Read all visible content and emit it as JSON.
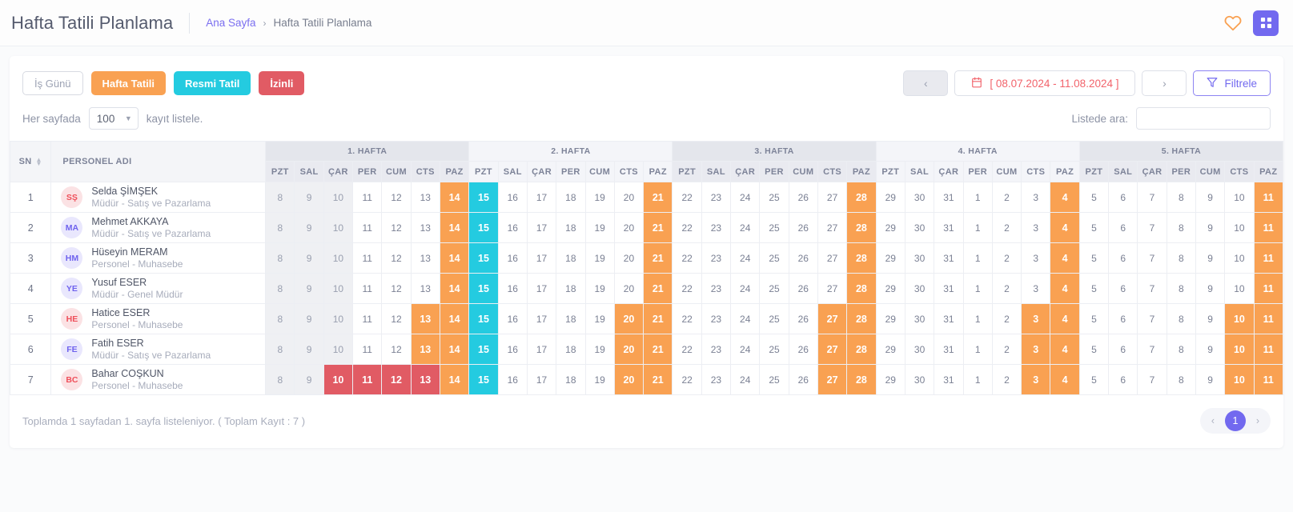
{
  "header": {
    "title": "Hafta Tatili Planlama",
    "breadcrumb_home": "Ana Sayfa",
    "breadcrumb_sep": "›",
    "breadcrumb_current": "Hafta Tatili Planlama",
    "heart_icon": "heart-icon",
    "grid_icon": "grid-apps-icon",
    "accent": "#7269ef"
  },
  "legend": [
    {
      "label": "İş Günü",
      "key": "work",
      "color": "#ffffff"
    },
    {
      "label": "Hafta Tatili",
      "key": "weekend",
      "color": "#f9a152"
    },
    {
      "label": "Resmi Tatil",
      "key": "official",
      "color": "#24cbe0"
    },
    {
      "label": "İzinli",
      "key": "leave",
      "color": "#e15b64"
    }
  ],
  "toolbar": {
    "prev_label": "‹",
    "next_label": "›",
    "date_range": "[ 08.07.2024 - 11.08.2024 ]",
    "calendar_icon": "calendar-icon",
    "filter_label": "Filtrele",
    "filter_icon": "funnel-icon"
  },
  "controls": {
    "per_page_prefix": "Her sayfada",
    "per_page_value": "100",
    "per_page_suffix": "kayıt listele.",
    "search_label": "Listede ara:",
    "search_value": "",
    "search_placeholder": ""
  },
  "table": {
    "col_sn": "SN",
    "col_name": "PERSONEL ADI",
    "sort_icon": "sort-arrows-icon",
    "weeks": [
      {
        "label": "1. HAFTA",
        "shade": "dark"
      },
      {
        "label": "2. HAFTA",
        "shade": "light"
      },
      {
        "label": "3. HAFTA",
        "shade": "dark"
      },
      {
        "label": "4. HAFTA",
        "shade": "light"
      },
      {
        "label": "5. HAFTA",
        "shade": "dark"
      }
    ],
    "day_names": [
      "PZT",
      "SAL",
      "ÇAR",
      "PER",
      "CUM",
      "CTS",
      "PAZ"
    ],
    "day_numbers": [
      8,
      9,
      10,
      11,
      12,
      13,
      14,
      15,
      16,
      17,
      18,
      19,
      20,
      21,
      22,
      23,
      24,
      25,
      26,
      27,
      28,
      29,
      30,
      31,
      1,
      2,
      3,
      4,
      5,
      6,
      7,
      8,
      9,
      10,
      11
    ],
    "muted_days": [
      0,
      1,
      2
    ],
    "rows": [
      {
        "sn": "1",
        "initials": "SŞ",
        "avatar": "red",
        "name": "Selda ŞİMŞEK",
        "role": "Müdür - Satış ve Pazarlama",
        "states": [
          "n",
          "n",
          "n",
          "n",
          "n",
          "n",
          "w",
          "o",
          "n",
          "n",
          "n",
          "n",
          "n",
          "w",
          "n",
          "n",
          "n",
          "n",
          "n",
          "n",
          "w",
          "n",
          "n",
          "n",
          "n",
          "n",
          "n",
          "w",
          "n",
          "n",
          "n",
          "n",
          "n",
          "n",
          "w"
        ]
      },
      {
        "sn": "2",
        "initials": "MA",
        "avatar": "pur",
        "name": "Mehmet AKKAYA",
        "role": "Müdür - Satış ve Pazarlama",
        "states": [
          "n",
          "n",
          "n",
          "n",
          "n",
          "n",
          "w",
          "o",
          "n",
          "n",
          "n",
          "n",
          "n",
          "w",
          "n",
          "n",
          "n",
          "n",
          "n",
          "n",
          "w",
          "n",
          "n",
          "n",
          "n",
          "n",
          "n",
          "w",
          "n",
          "n",
          "n",
          "n",
          "n",
          "n",
          "w"
        ]
      },
      {
        "sn": "3",
        "initials": "HM",
        "avatar": "pur",
        "name": "Hüseyin MERAM",
        "role": "Personel - Muhasebe",
        "states": [
          "n",
          "n",
          "n",
          "n",
          "n",
          "n",
          "w",
          "o",
          "n",
          "n",
          "n",
          "n",
          "n",
          "w",
          "n",
          "n",
          "n",
          "n",
          "n",
          "n",
          "w",
          "n",
          "n",
          "n",
          "n",
          "n",
          "n",
          "w",
          "n",
          "n",
          "n",
          "n",
          "n",
          "n",
          "w"
        ]
      },
      {
        "sn": "4",
        "initials": "YE",
        "avatar": "pur",
        "name": "Yusuf ESER",
        "role": "Müdür - Genel Müdür",
        "states": [
          "n",
          "n",
          "n",
          "n",
          "n",
          "n",
          "w",
          "o",
          "n",
          "n",
          "n",
          "n",
          "n",
          "w",
          "n",
          "n",
          "n",
          "n",
          "n",
          "n",
          "w",
          "n",
          "n",
          "n",
          "n",
          "n",
          "n",
          "w",
          "n",
          "n",
          "n",
          "n",
          "n",
          "n",
          "w"
        ]
      },
      {
        "sn": "5",
        "initials": "HE",
        "avatar": "red",
        "name": "Hatice ESER",
        "role": "Personel - Muhasebe",
        "states": [
          "n",
          "n",
          "n",
          "n",
          "n",
          "w",
          "w",
          "o",
          "n",
          "n",
          "n",
          "n",
          "w",
          "w",
          "n",
          "n",
          "n",
          "n",
          "n",
          "w",
          "w",
          "n",
          "n",
          "n",
          "n",
          "n",
          "w",
          "w",
          "n",
          "n",
          "n",
          "n",
          "n",
          "w",
          "w"
        ]
      },
      {
        "sn": "6",
        "initials": "FE",
        "avatar": "pur",
        "name": "Fatih ESER",
        "role": "Müdür - Satış ve Pazarlama",
        "states": [
          "n",
          "n",
          "n",
          "n",
          "n",
          "w",
          "w",
          "o",
          "n",
          "n",
          "n",
          "n",
          "w",
          "w",
          "n",
          "n",
          "n",
          "n",
          "n",
          "w",
          "w",
          "n",
          "n",
          "n",
          "n",
          "n",
          "w",
          "w",
          "n",
          "n",
          "n",
          "n",
          "n",
          "w",
          "w"
        ]
      },
      {
        "sn": "7",
        "initials": "BC",
        "avatar": "red",
        "name": "Bahar COŞKUN",
        "role": "Personel - Muhasebe",
        "states": [
          "n",
          "n",
          "l",
          "l",
          "l",
          "l",
          "w",
          "o",
          "n",
          "n",
          "n",
          "n",
          "w",
          "w",
          "n",
          "n",
          "n",
          "n",
          "n",
          "w",
          "w",
          "n",
          "n",
          "n",
          "n",
          "n",
          "w",
          "w",
          "n",
          "n",
          "n",
          "n",
          "n",
          "w",
          "w"
        ]
      }
    ]
  },
  "footer": {
    "summary": "Toplamda 1 sayfadan 1. sayfa listeleniyor. ( Toplam Kayıt : 7 )",
    "prev": "‹",
    "next": "›",
    "pages": [
      "1"
    ],
    "active_page": "1"
  }
}
